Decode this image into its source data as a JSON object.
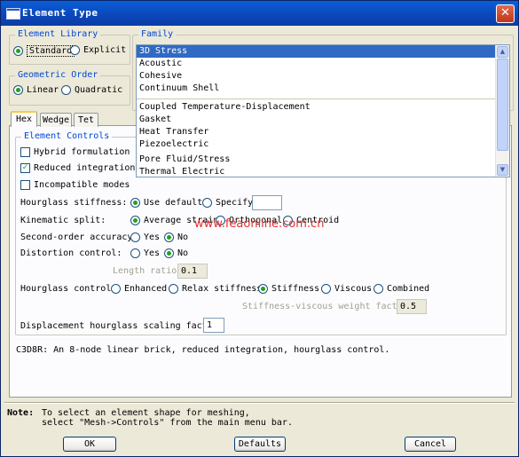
{
  "window": {
    "title": "Element Type",
    "close_glyph": "✕"
  },
  "element_library": {
    "legend": "Element Library",
    "options": [
      {
        "label": "Standard",
        "selected": true
      },
      {
        "label": "Explicit",
        "selected": false
      }
    ]
  },
  "geometric_order": {
    "legend": "Geometric Order",
    "options": [
      {
        "label": "Linear",
        "selected": true
      },
      {
        "label": "Quadratic",
        "selected": false
      }
    ]
  },
  "family": {
    "legend": "Family",
    "items": [
      "3D Stress",
      "Acoustic",
      "Cohesive",
      "Continuum Shell",
      "Coupled Temperature-Displacement",
      "Gasket",
      "Heat Transfer",
      "Piezoelectric",
      "Pore Fluid/Stress",
      "Thermal Electric"
    ],
    "selected": "3D Stress"
  },
  "tabs": [
    {
      "label": "Hex",
      "active": true
    },
    {
      "label": "Wedge",
      "active": false
    },
    {
      "label": "Tet",
      "active": false
    }
  ],
  "element_controls": {
    "legend": "Element Controls",
    "checkboxes": [
      {
        "label": "Hybrid formulation",
        "checked": false
      },
      {
        "label": "Reduced integration",
        "checked": true
      },
      {
        "label": "Incompatible modes",
        "checked": false
      }
    ],
    "hourglass_stiffness": {
      "label": "Hourglass stiffness:",
      "use_default": "Use default",
      "specify": "Specify",
      "selected": "Use default",
      "value": ""
    },
    "kinematic_split": {
      "label": "Kinematic split:",
      "options": [
        "Average strain",
        "Orthogonal",
        "Centroid"
      ],
      "selected": "Average strain"
    },
    "second_order_accuracy": {
      "label": "Second-order accuracy:",
      "options": [
        "Yes",
        "No"
      ],
      "selected": "No"
    },
    "distortion_control": {
      "label": "Distortion control:",
      "options": [
        "Yes",
        "No"
      ],
      "selected": "No"
    },
    "length_ratio": {
      "label": "Length ratio:",
      "value": "0.1"
    },
    "hourglass_control": {
      "label": "Hourglass control:",
      "options": [
        "Enhanced",
        "Relax stiffness",
        "Stiffness",
        "Viscous",
        "Combined"
      ],
      "selected": "Stiffness"
    },
    "stiffness_viscous_weight": {
      "label": "Stiffness-viscous weight factor:",
      "value": "0.5"
    },
    "displacement_scaling": {
      "label": "Displacement hourglass scaling factor:",
      "value": "1"
    }
  },
  "description": "C3D8R:  An 8-node linear brick, reduced integration, hourglass control.",
  "note": {
    "prefix": "Note:",
    "line1": "To select an element shape for meshing,",
    "line2": "select \"Mesh->Controls\" from the main menu bar."
  },
  "buttons": {
    "ok": "OK",
    "defaults": "Defaults",
    "cancel": "Cancel"
  },
  "watermark": "www.feaonline.com.cn",
  "colors": {
    "title_bar": "#0b46b8",
    "legend_text": "#0046d5",
    "selection": "#316ac5",
    "tab_highlight": "#ffc83c"
  }
}
